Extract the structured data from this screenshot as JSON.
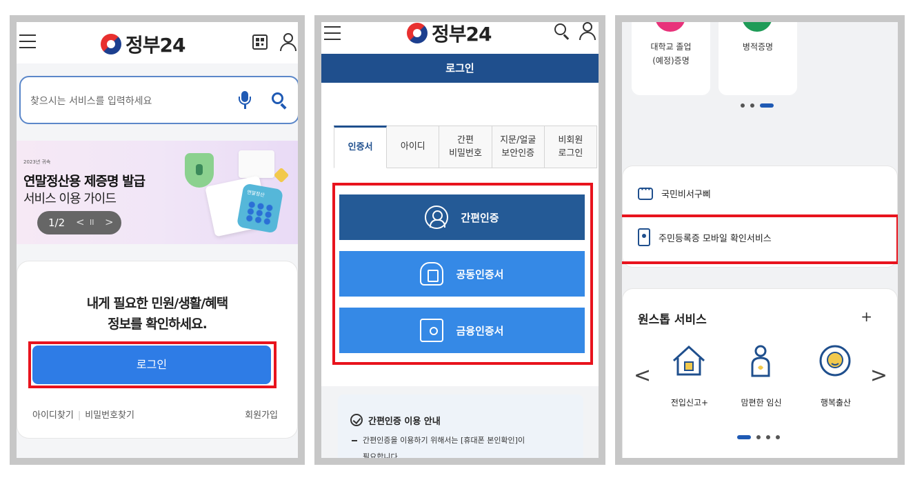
{
  "screen1": {
    "logo_text": "정부24",
    "search_placeholder": "찾으시는 서비스를 입력하세요",
    "banner": {
      "tag": "2023년 귀속",
      "title": "연말정산용 제증명 발급",
      "subtitle": "서비스 이용 가이드",
      "pager": "1/2",
      "prev": "<",
      "pause": "II",
      "next": ">",
      "illustration_label": "연말정산"
    },
    "login_card": {
      "message_line1": "내게 필요한 민원/생활/혜택",
      "message_line2": "정보를 확인하세요.",
      "login_label": "로그인",
      "find_id": "아이디찾기",
      "find_pw": "비밀번호찾기",
      "join": "회원가입"
    }
  },
  "screen2": {
    "logo_text": "정부24",
    "title": "로그인",
    "tabs": [
      {
        "label": "인증서"
      },
      {
        "label": "아이디"
      },
      {
        "label": "간편\n비밀번호"
      },
      {
        "label": "지문/얼굴\n보안인증"
      },
      {
        "label": "비회원\n로그인"
      }
    ],
    "options": [
      {
        "label": "간편인증",
        "icon": "user-circle-icon",
        "color": "#245a96"
      },
      {
        "label": "공동인증서",
        "icon": "cloud-certificate-icon",
        "color": "#3589e6"
      },
      {
        "label": "금융인증서",
        "icon": "safe-icon",
        "color": "#3589e6"
      }
    ],
    "info": {
      "heading": "간편인증 이용 안내",
      "body_line1": "간편인증을 이용하기 위해서는 [휴대폰 본인확인]이",
      "body_line2": "필요합니다."
    }
  },
  "screen3": {
    "tiles": [
      {
        "label": "대학교 졸업\n(예정)증명",
        "color": "#e8327a"
      },
      {
        "label": "병적증명",
        "color": "#1e9b57"
      }
    ],
    "services": {
      "item1": "국민비서구삐",
      "item2": "주민등록증 모바일 확인서비스"
    },
    "oneshot": {
      "title": "원스톱 서비스",
      "plus": "+",
      "prev": "<",
      "next": ">",
      "items": [
        {
          "label": "전입신고+",
          "icon": "house-icon"
        },
        {
          "label": "맘편한 임신",
          "icon": "pregnancy-icon"
        },
        {
          "label": "행복출산",
          "icon": "baby-icon"
        }
      ]
    }
  },
  "colors": {
    "primary_blue": "#2e7ce6",
    "navy": "#1f4f8d",
    "highlight_red": "#e8131d"
  }
}
